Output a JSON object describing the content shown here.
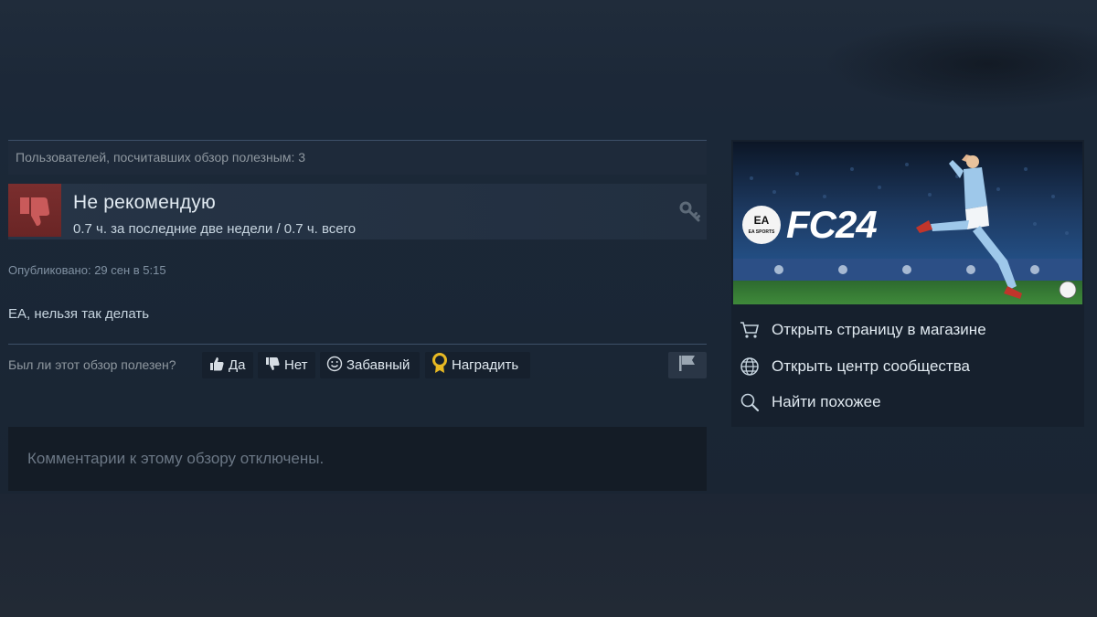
{
  "review": {
    "helpful_count_text": "Пользователей, посчитавших обзор полезным: 3",
    "verdict": "Не рекомендую",
    "hours": "0.7 ч. за последние две недели / 0.7 ч. всего",
    "posted": "Опубликовано: 29 сен в 5:15",
    "body": "EA, нельзя так делать",
    "comments_disabled": "Комментарии к этому обзору отключены."
  },
  "vote": {
    "question": "Был ли этот обзор полезен?",
    "yes_label": "Да",
    "no_label": "Нет",
    "funny_label": "Забавный",
    "award_label": "Наградить"
  },
  "game": {
    "logo_badge": "EA SPORTS",
    "logo_text": "FC24",
    "links": [
      {
        "label": "Открыть страницу в магазине",
        "icon": "cart-icon"
      },
      {
        "label": "Открыть центр сообщества",
        "icon": "globe-icon"
      },
      {
        "label": "Найти похожее",
        "icon": "search-icon"
      }
    ]
  },
  "colors": {
    "background": "#1b2838",
    "negative_thumb": "#7a2e2e",
    "award_gold": "#e8b923",
    "text_primary": "#e0e9f0",
    "text_muted": "#8f98a0"
  }
}
